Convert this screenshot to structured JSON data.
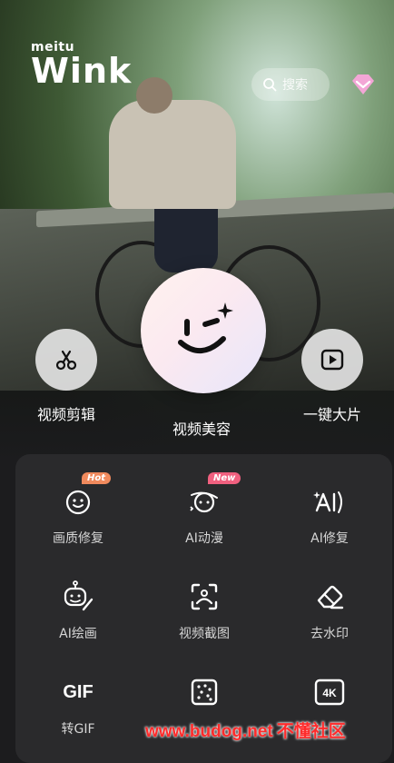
{
  "brand": {
    "small": "meitu",
    "big": "Wink"
  },
  "search": {
    "placeholder": "搜索",
    "icon": "search-icon"
  },
  "header": {
    "vip_icon": "diamond-icon",
    "vip_color": "#f3a6d6"
  },
  "main_actions": [
    {
      "label": "视频剪辑",
      "icon": "scissors-icon"
    },
    {
      "label": "视频美容",
      "icon": "smile-wink-icon"
    },
    {
      "label": "一键大片",
      "icon": "play-icon"
    }
  ],
  "tools": [
    {
      "label": "画质修复",
      "icon": "face-sparkle-icon",
      "badge": "Hot"
    },
    {
      "label": "AI动漫",
      "icon": "ai-anime-icon",
      "badge": "New"
    },
    {
      "label": "AI修复",
      "icon": "ai-repair-icon"
    },
    {
      "label": "AI绘画",
      "icon": "ai-paint-icon"
    },
    {
      "label": "视频截图",
      "icon": "screenshot-icon"
    },
    {
      "label": "去水印",
      "icon": "eraser-icon"
    },
    {
      "label": "转GIF",
      "icon_text": "GIF"
    },
    {
      "label": "",
      "icon": "dots-grid-icon"
    },
    {
      "label": "",
      "icon": "4k-icon",
      "icon_text": "4K"
    }
  ],
  "watermark": {
    "url": "www.budog.net",
    "text": "不懂社区"
  },
  "colors": {
    "badge_hot": "#f08a5d",
    "badge_new": "#f0607f",
    "panel": "#2a2a2c",
    "watermark": "#ff2b2b"
  }
}
